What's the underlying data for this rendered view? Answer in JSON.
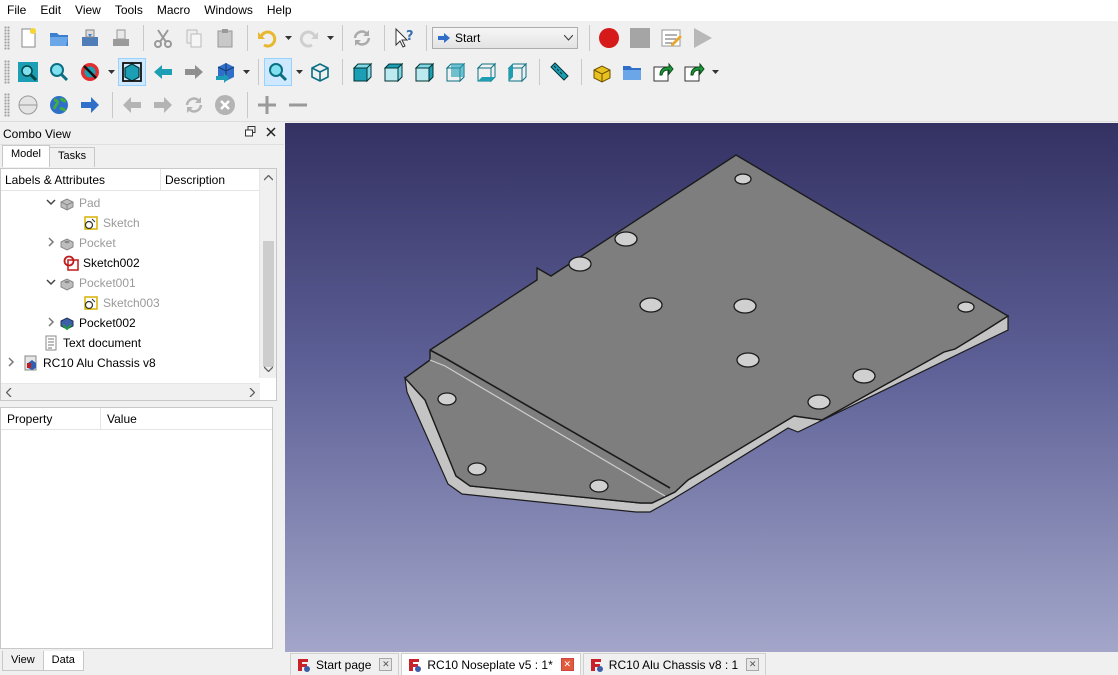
{
  "menubar": {
    "items": [
      "File",
      "Edit",
      "View",
      "Tools",
      "Macro",
      "Windows",
      "Help"
    ]
  },
  "toolbar": {
    "workbench_combo": "Start"
  },
  "combo_view": {
    "title": "Combo View",
    "tabs": [
      "Model",
      "Tasks"
    ],
    "tree": {
      "columns": [
        "Labels & Attributes",
        "Description"
      ],
      "rows": [
        {
          "label": "Pad",
          "dim": true,
          "expanded": true,
          "icon": "pad-icon"
        },
        {
          "label": "Sketch",
          "dim": true,
          "icon": "sketch-icon"
        },
        {
          "label": "Pocket",
          "dim": true,
          "collapsed": true,
          "icon": "pocket-icon"
        },
        {
          "label": "Sketch002",
          "dim": false,
          "icon": "sketch-error-icon"
        },
        {
          "label": "Pocket001",
          "dim": true,
          "expanded": true,
          "icon": "pocket-icon"
        },
        {
          "label": "Sketch003",
          "dim": true,
          "icon": "sketch-icon"
        },
        {
          "label": "Pocket002",
          "dim": false,
          "collapsed": true,
          "icon": "pocket-active-icon"
        },
        {
          "label": "Text document",
          "dim": false,
          "icon": "text-document-icon"
        },
        {
          "label": "RC10 Alu Chassis v8",
          "dim": false,
          "collapsed": true,
          "icon": "document-icon"
        }
      ]
    },
    "property_columns": [
      "Property",
      "Value"
    ],
    "bottom_tabs": [
      "View",
      "Data"
    ]
  },
  "doc_tabs": [
    {
      "label": "Start page"
    },
    {
      "label": "RC10 Noseplate v5 : 1*"
    },
    {
      "label": "RC10 Alu Chassis v8 : 1"
    }
  ]
}
